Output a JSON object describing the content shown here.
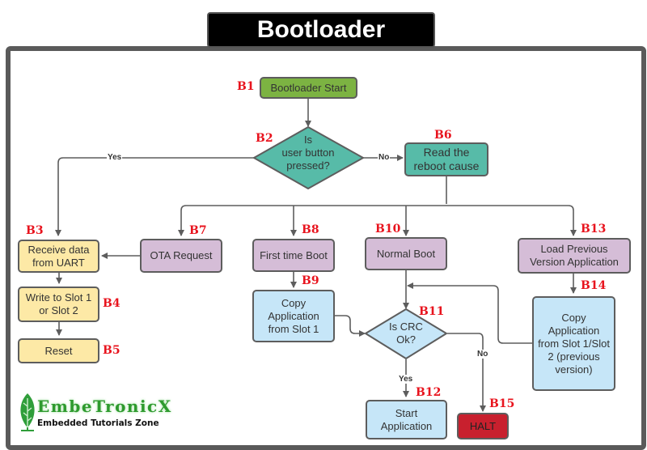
{
  "title": "Bootloader",
  "colors": {
    "start": "#7cb342",
    "decision_user": "#57bba8",
    "uart_path": "#fde9a6",
    "boot_type": "#d5bdd7",
    "copy": "#c6e6f8",
    "halt": "#c8202e",
    "tag_text": "#e8141e"
  },
  "nodes": {
    "b1": {
      "tag": "B1",
      "label": "Bootloader Start"
    },
    "b2": {
      "tag": "B2",
      "label_lines": [
        "Is",
        "user button",
        "pressed?"
      ]
    },
    "b3": {
      "tag": "B3",
      "label": "Receive data from UART"
    },
    "b4": {
      "tag": "B4",
      "label": "Write to Slot 1 or Slot 2"
    },
    "b5": {
      "tag": "B5",
      "label": "Reset"
    },
    "b6": {
      "tag": "B6",
      "label": "Read the reboot cause"
    },
    "b7": {
      "tag": "B7",
      "label": "OTA Request"
    },
    "b8": {
      "tag": "B8",
      "label": "First time Boot"
    },
    "b9": {
      "tag": "B9",
      "label": "Copy Application from Slot 1"
    },
    "b10": {
      "tag": "B10",
      "label": "Normal Boot"
    },
    "b11": {
      "tag": "B11",
      "label_lines": [
        "Is CRC",
        "Ok?"
      ]
    },
    "b12": {
      "tag": "B12",
      "label": "Start Application"
    },
    "b13": {
      "tag": "B13",
      "label": "Load Previous Version Application"
    },
    "b14": {
      "tag": "B14",
      "label": "Copy Application from Slot 1/Slot 2 (previous version)"
    },
    "b15": {
      "tag": "B15",
      "label": "HALT"
    }
  },
  "edge_labels": {
    "b2_yes": "Yes",
    "b2_no": "No",
    "b11_yes": "Yes",
    "b11_no": "No"
  },
  "logo": {
    "name": "EmbeTronicX",
    "tagline": "Embedded Tutorials Zone",
    "icon": "leaf-circuit-icon"
  }
}
